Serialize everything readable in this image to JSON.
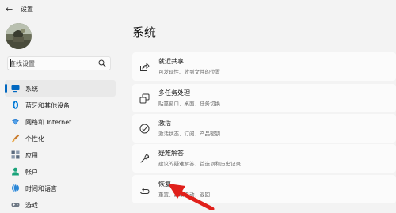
{
  "window": {
    "title": "设置"
  },
  "search": {
    "placeholder": "查找设置"
  },
  "page": {
    "title": "系统"
  },
  "sidebar": {
    "items": [
      {
        "label": "系统",
        "icon": "monitor-icon",
        "active": true
      },
      {
        "label": "蓝牙和其他设备",
        "icon": "bluetooth-icon",
        "active": false
      },
      {
        "label": "网络和 Internet",
        "icon": "wifi-icon",
        "active": false
      },
      {
        "label": "个性化",
        "icon": "brush-icon",
        "active": false
      },
      {
        "label": "应用",
        "icon": "apps-icon",
        "active": false
      },
      {
        "label": "帐户",
        "icon": "person-icon",
        "active": false
      },
      {
        "label": "时间和语言",
        "icon": "globe-icon",
        "active": false
      },
      {
        "label": "游戏",
        "icon": "gamepad-icon",
        "active": false
      }
    ]
  },
  "settings": [
    {
      "title": "就近共享",
      "desc": "可发现性、收到文件的位置",
      "icon": "share-icon"
    },
    {
      "title": "多任务处理",
      "desc": "贴靠窗口、桌面、任务切换",
      "icon": "multitask-icon"
    },
    {
      "title": "激活",
      "desc": "激活状态、订阅、产品密钥",
      "icon": "check-circle-icon"
    },
    {
      "title": "疑难解答",
      "desc": "建议的疑难解答、首选项和历史记录",
      "icon": "wrench-icon"
    },
    {
      "title": "恢复",
      "desc": "重置、高级启动、返回",
      "icon": "recovery-icon"
    }
  ],
  "colors": {
    "accent": "#0067c0",
    "pointer": "#e0201b",
    "background": "#f3f3f3",
    "card": "#fbfbfb"
  }
}
